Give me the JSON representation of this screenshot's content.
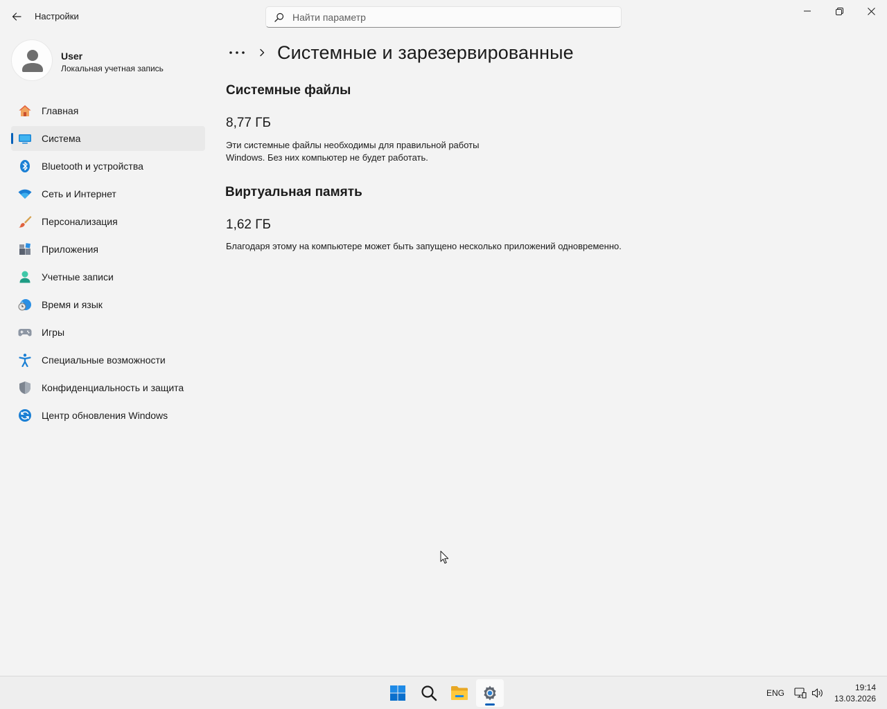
{
  "app": {
    "title": "Настройки"
  },
  "search": {
    "placeholder": "Найти параметр"
  },
  "window": {
    "min_icon": "minimize-icon",
    "max_icon": "restore-icon",
    "close_icon": "close-icon"
  },
  "profile": {
    "name": "User",
    "account_type": "Локальная учетная запись"
  },
  "sidebar": {
    "items": [
      {
        "label": "Главная",
        "icon": "home-icon",
        "selected": false
      },
      {
        "label": "Система",
        "icon": "system-icon",
        "selected": true
      },
      {
        "label": "Bluetooth и устройства",
        "icon": "bluetooth-icon",
        "selected": false
      },
      {
        "label": "Сеть и Интернет",
        "icon": "wifi-icon",
        "selected": false
      },
      {
        "label": "Персонализация",
        "icon": "brush-icon",
        "selected": false
      },
      {
        "label": "Приложения",
        "icon": "apps-icon",
        "selected": false
      },
      {
        "label": "Учетные записи",
        "icon": "accounts-icon",
        "selected": false
      },
      {
        "label": "Время и язык",
        "icon": "time-language-icon",
        "selected": false
      },
      {
        "label": "Игры",
        "icon": "gamepad-icon",
        "selected": false
      },
      {
        "label": "Специальные возможности",
        "icon": "accessibility-icon",
        "selected": false
      },
      {
        "label": "Конфиденциальность и защита",
        "icon": "shield-icon",
        "selected": false
      },
      {
        "label": "Центр обновления Windows",
        "icon": "update-icon",
        "selected": false
      }
    ]
  },
  "main": {
    "breadcrumb_more": "•••",
    "page_title": "Системные и зарезервированные",
    "sections": [
      {
        "title": "Системные файлы",
        "value": "8,77 ГБ",
        "description_line1": "Эти системные файлы необходимы для правильной работы",
        "description_line2": "Windows. Без них компьютер не будет работать."
      },
      {
        "title": "Виртуальная память",
        "value": "1,62 ГБ",
        "description_line1": "Благодаря этому на компьютере может быть запущено несколько приложений одновременно."
      }
    ]
  },
  "taskbar": {
    "apps": [
      "start-icon",
      "search-icon",
      "file-explorer-icon",
      "settings-icon"
    ],
    "active_app": "settings-icon",
    "language": "ENG",
    "time": "19:14",
    "date": "13.03.2026"
  },
  "colors": {
    "accent": "#005fb8",
    "background": "#f3f3f3",
    "selected_item": "#e9e9e9"
  }
}
